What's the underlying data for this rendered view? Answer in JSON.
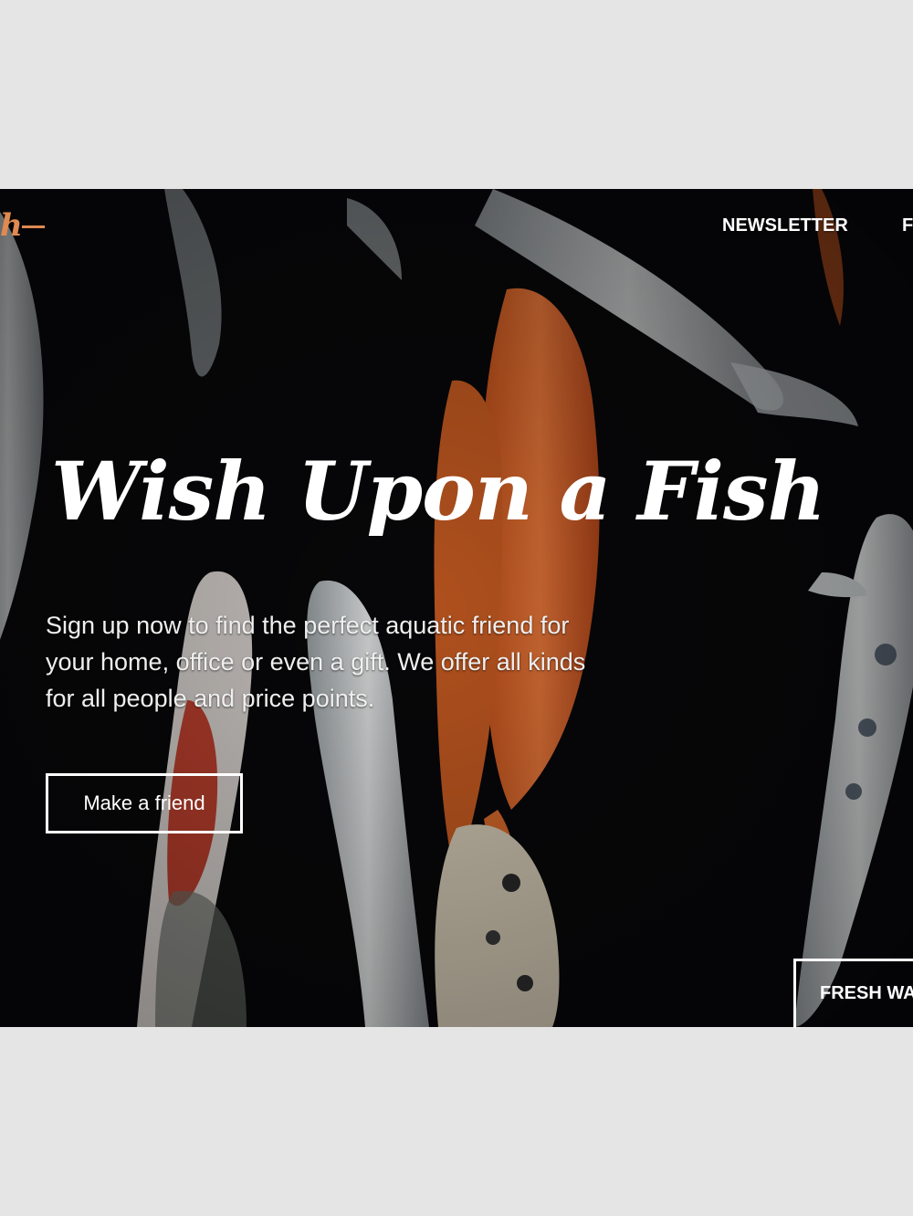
{
  "brand": {
    "logo_fragment": "h",
    "accent_color": "#e08a52"
  },
  "nav": {
    "newsletter": "NEWSLETTER",
    "next_item_fragment": "F"
  },
  "hero": {
    "title": "Wish Upon a Fish",
    "description": "Sign up now to find the perfect aquatic friend for your home, office or even a gift. We offer all kinds for all people and price points.",
    "cta_label": "Make a friend",
    "tag_fragment": "FRESH WA"
  }
}
